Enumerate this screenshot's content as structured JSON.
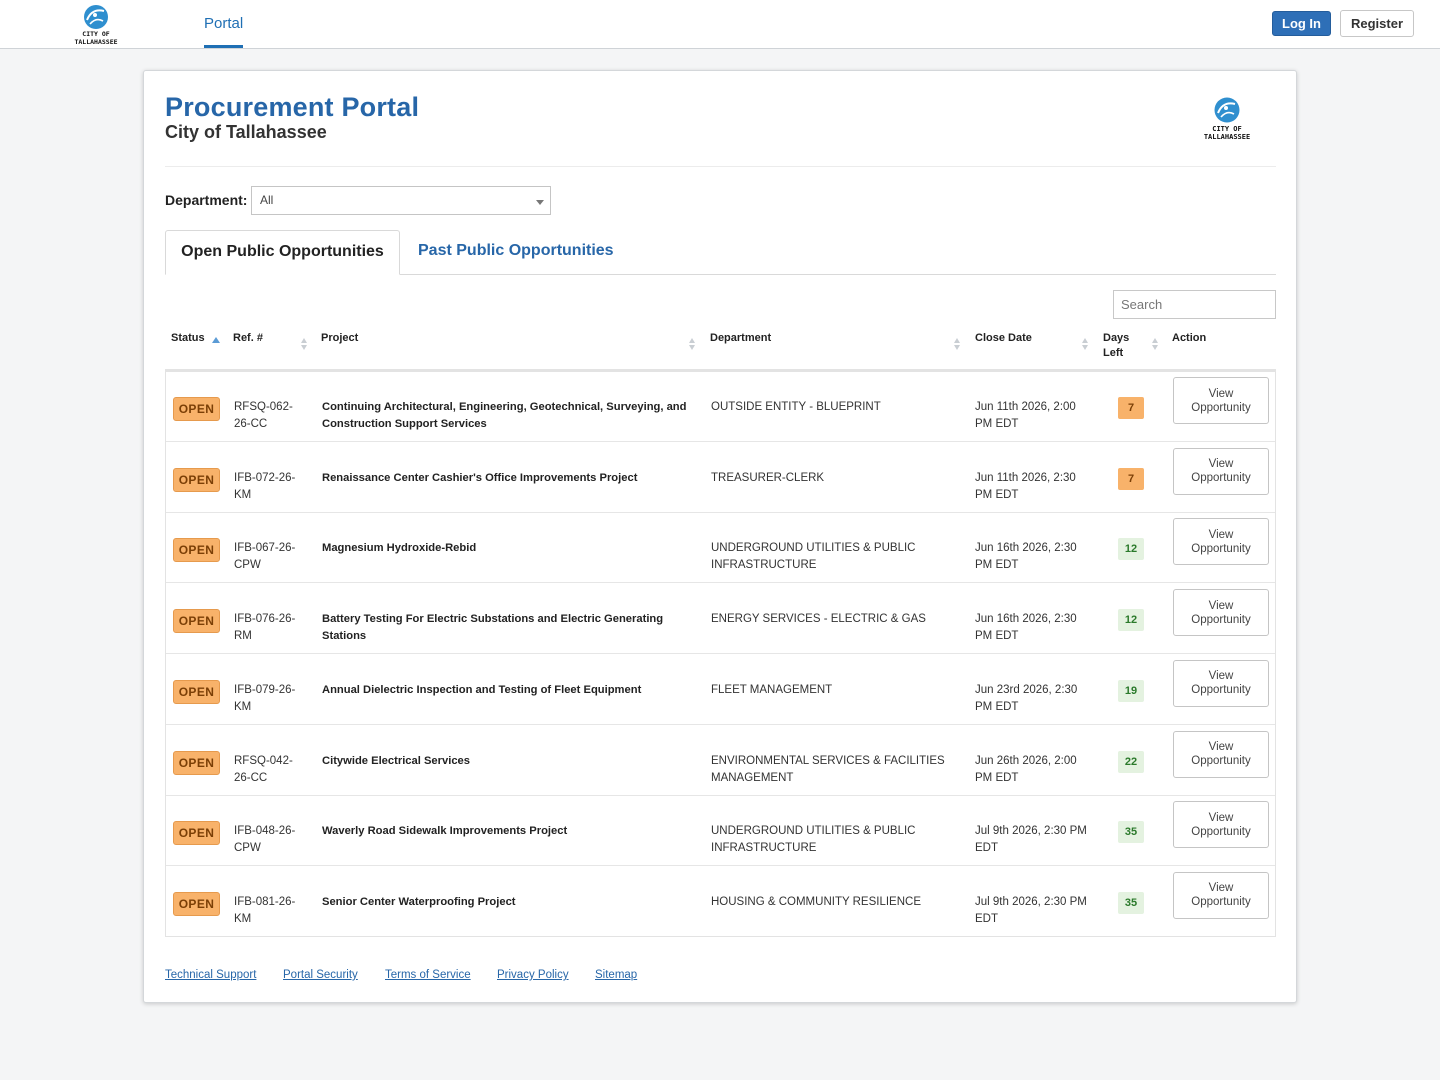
{
  "nav": {
    "portal_label": "Portal",
    "login_label": "Log In",
    "register_label": "Register"
  },
  "logo": {
    "line1": "CITY OF",
    "line2": "TALLAHASSEE"
  },
  "header": {
    "title": "Procurement Portal",
    "subtitle": "City of Tallahassee"
  },
  "filter": {
    "department_label": "Department:",
    "department_value": "All"
  },
  "tabs": [
    {
      "label": "Open Public Opportunities",
      "active": true
    },
    {
      "label": "Past Public Opportunities",
      "active": false
    }
  ],
  "search": {
    "placeholder": "Search"
  },
  "table": {
    "columns": [
      "Status",
      "Ref. #",
      "Project",
      "Department",
      "Close Date",
      "Days Left",
      "Action"
    ],
    "rows": [
      {
        "status": "OPEN",
        "ref": "RFSQ-062-26-CC",
        "project": "Continuing Architectural, Engineering, Geotechnical, Surveying, and Construction Support Services",
        "department": "OUTSIDE ENTITY - BLUEPRINT",
        "close_date": "Jun 11th 2026, 2:00 PM EDT",
        "days_left": "7",
        "urgent": true,
        "action": "View Opportunity"
      },
      {
        "status": "OPEN",
        "ref": "IFB-072-26-KM",
        "project": "Renaissance Center Cashier's Office Improvements Project",
        "department": "TREASURER-CLERK",
        "close_date": "Jun 11th 2026, 2:30 PM EDT",
        "days_left": "7",
        "urgent": true,
        "action": "View Opportunity"
      },
      {
        "status": "OPEN",
        "ref": "IFB-067-26-CPW",
        "project": "Magnesium Hydroxide-Rebid",
        "department": "UNDERGROUND UTILITIES & PUBLIC INFRASTRUCTURE",
        "close_date": "Jun 16th 2026, 2:30 PM EDT",
        "days_left": "12",
        "urgent": false,
        "action": "View Opportunity"
      },
      {
        "status": "OPEN",
        "ref": "IFB-076-26-RM",
        "project": "Battery Testing For Electric Substations and Electric Generating Stations",
        "department": "ENERGY SERVICES - ELECTRIC & GAS",
        "close_date": "Jun 16th 2026, 2:30 PM EDT",
        "days_left": "12",
        "urgent": false,
        "action": "View Opportunity"
      },
      {
        "status": "OPEN",
        "ref": "IFB-079-26-KM",
        "project": "Annual Dielectric Inspection and Testing of Fleet Equipment",
        "department": "FLEET MANAGEMENT",
        "close_date": "Jun 23rd 2026, 2:30 PM EDT",
        "days_left": "19",
        "urgent": false,
        "action": "View Opportunity"
      },
      {
        "status": "OPEN",
        "ref": "RFSQ-042-26-CC",
        "project": "Citywide Electrical Services",
        "department": "ENVIRONMENTAL SERVICES & FACILITIES MANAGEMENT",
        "close_date": "Jun 26th 2026, 2:00 PM EDT",
        "days_left": "22",
        "urgent": false,
        "action": "View Opportunity"
      },
      {
        "status": "OPEN",
        "ref": "IFB-048-26-CPW",
        "project": "Waverly Road Sidewalk Improvements Project",
        "department": "UNDERGROUND UTILITIES & PUBLIC INFRASTRUCTURE",
        "close_date": "Jul 9th 2026, 2:30 PM EDT",
        "days_left": "35",
        "urgent": false,
        "action": "View Opportunity"
      },
      {
        "status": "OPEN",
        "ref": "IFB-081-26-KM",
        "project": "Senior Center Waterproofing Project",
        "department": "HOUSING & COMMUNITY RESILIENCE",
        "close_date": "Jul 9th 2026, 2:30 PM EDT",
        "days_left": "35",
        "urgent": false,
        "action": "View Opportunity"
      }
    ]
  },
  "footer": {
    "links": [
      "Technical Support",
      "Portal Security",
      "Terms of Service",
      "Privacy Policy",
      "Sitemap"
    ]
  },
  "colors": {
    "brand_blue": "#2766a8",
    "open_badge": "#f8b26a",
    "days_ok": "#e4f2e0"
  }
}
